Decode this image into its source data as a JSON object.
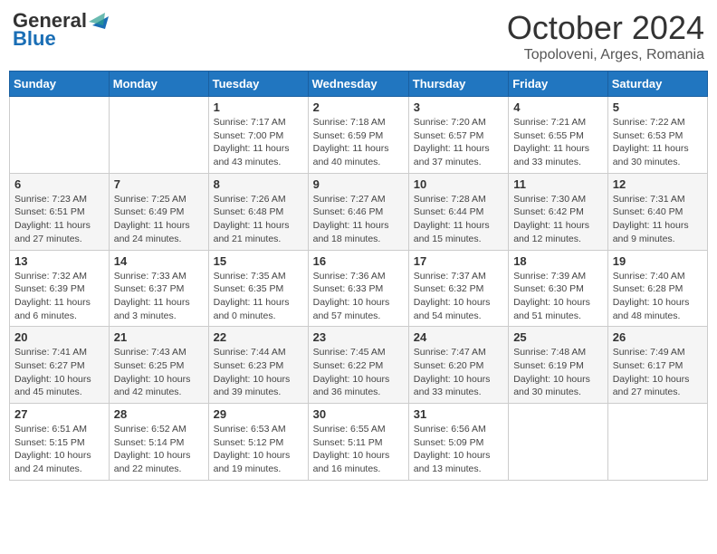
{
  "header": {
    "logo_general": "General",
    "logo_blue": "Blue",
    "title": "October 2024",
    "subtitle": "Topoloveni, Arges, Romania"
  },
  "calendar": {
    "days_of_week": [
      "Sunday",
      "Monday",
      "Tuesday",
      "Wednesday",
      "Thursday",
      "Friday",
      "Saturday"
    ],
    "weeks": [
      [
        {
          "day": "",
          "info": ""
        },
        {
          "day": "",
          "info": ""
        },
        {
          "day": "1",
          "info": "Sunrise: 7:17 AM\nSunset: 7:00 PM\nDaylight: 11 hours and 43 minutes."
        },
        {
          "day": "2",
          "info": "Sunrise: 7:18 AM\nSunset: 6:59 PM\nDaylight: 11 hours and 40 minutes."
        },
        {
          "day": "3",
          "info": "Sunrise: 7:20 AM\nSunset: 6:57 PM\nDaylight: 11 hours and 37 minutes."
        },
        {
          "day": "4",
          "info": "Sunrise: 7:21 AM\nSunset: 6:55 PM\nDaylight: 11 hours and 33 minutes."
        },
        {
          "day": "5",
          "info": "Sunrise: 7:22 AM\nSunset: 6:53 PM\nDaylight: 11 hours and 30 minutes."
        }
      ],
      [
        {
          "day": "6",
          "info": "Sunrise: 7:23 AM\nSunset: 6:51 PM\nDaylight: 11 hours and 27 minutes."
        },
        {
          "day": "7",
          "info": "Sunrise: 7:25 AM\nSunset: 6:49 PM\nDaylight: 11 hours and 24 minutes."
        },
        {
          "day": "8",
          "info": "Sunrise: 7:26 AM\nSunset: 6:48 PM\nDaylight: 11 hours and 21 minutes."
        },
        {
          "day": "9",
          "info": "Sunrise: 7:27 AM\nSunset: 6:46 PM\nDaylight: 11 hours and 18 minutes."
        },
        {
          "day": "10",
          "info": "Sunrise: 7:28 AM\nSunset: 6:44 PM\nDaylight: 11 hours and 15 minutes."
        },
        {
          "day": "11",
          "info": "Sunrise: 7:30 AM\nSunset: 6:42 PM\nDaylight: 11 hours and 12 minutes."
        },
        {
          "day": "12",
          "info": "Sunrise: 7:31 AM\nSunset: 6:40 PM\nDaylight: 11 hours and 9 minutes."
        }
      ],
      [
        {
          "day": "13",
          "info": "Sunrise: 7:32 AM\nSunset: 6:39 PM\nDaylight: 11 hours and 6 minutes."
        },
        {
          "day": "14",
          "info": "Sunrise: 7:33 AM\nSunset: 6:37 PM\nDaylight: 11 hours and 3 minutes."
        },
        {
          "day": "15",
          "info": "Sunrise: 7:35 AM\nSunset: 6:35 PM\nDaylight: 11 hours and 0 minutes."
        },
        {
          "day": "16",
          "info": "Sunrise: 7:36 AM\nSunset: 6:33 PM\nDaylight: 10 hours and 57 minutes."
        },
        {
          "day": "17",
          "info": "Sunrise: 7:37 AM\nSunset: 6:32 PM\nDaylight: 10 hours and 54 minutes."
        },
        {
          "day": "18",
          "info": "Sunrise: 7:39 AM\nSunset: 6:30 PM\nDaylight: 10 hours and 51 minutes."
        },
        {
          "day": "19",
          "info": "Sunrise: 7:40 AM\nSunset: 6:28 PM\nDaylight: 10 hours and 48 minutes."
        }
      ],
      [
        {
          "day": "20",
          "info": "Sunrise: 7:41 AM\nSunset: 6:27 PM\nDaylight: 10 hours and 45 minutes."
        },
        {
          "day": "21",
          "info": "Sunrise: 7:43 AM\nSunset: 6:25 PM\nDaylight: 10 hours and 42 minutes."
        },
        {
          "day": "22",
          "info": "Sunrise: 7:44 AM\nSunset: 6:23 PM\nDaylight: 10 hours and 39 minutes."
        },
        {
          "day": "23",
          "info": "Sunrise: 7:45 AM\nSunset: 6:22 PM\nDaylight: 10 hours and 36 minutes."
        },
        {
          "day": "24",
          "info": "Sunrise: 7:47 AM\nSunset: 6:20 PM\nDaylight: 10 hours and 33 minutes."
        },
        {
          "day": "25",
          "info": "Sunrise: 7:48 AM\nSunset: 6:19 PM\nDaylight: 10 hours and 30 minutes."
        },
        {
          "day": "26",
          "info": "Sunrise: 7:49 AM\nSunset: 6:17 PM\nDaylight: 10 hours and 27 minutes."
        }
      ],
      [
        {
          "day": "27",
          "info": "Sunrise: 6:51 AM\nSunset: 5:15 PM\nDaylight: 10 hours and 24 minutes."
        },
        {
          "day": "28",
          "info": "Sunrise: 6:52 AM\nSunset: 5:14 PM\nDaylight: 10 hours and 22 minutes."
        },
        {
          "day": "29",
          "info": "Sunrise: 6:53 AM\nSunset: 5:12 PM\nDaylight: 10 hours and 19 minutes."
        },
        {
          "day": "30",
          "info": "Sunrise: 6:55 AM\nSunset: 5:11 PM\nDaylight: 10 hours and 16 minutes."
        },
        {
          "day": "31",
          "info": "Sunrise: 6:56 AM\nSunset: 5:09 PM\nDaylight: 10 hours and 13 minutes."
        },
        {
          "day": "",
          "info": ""
        },
        {
          "day": "",
          "info": ""
        }
      ]
    ]
  }
}
